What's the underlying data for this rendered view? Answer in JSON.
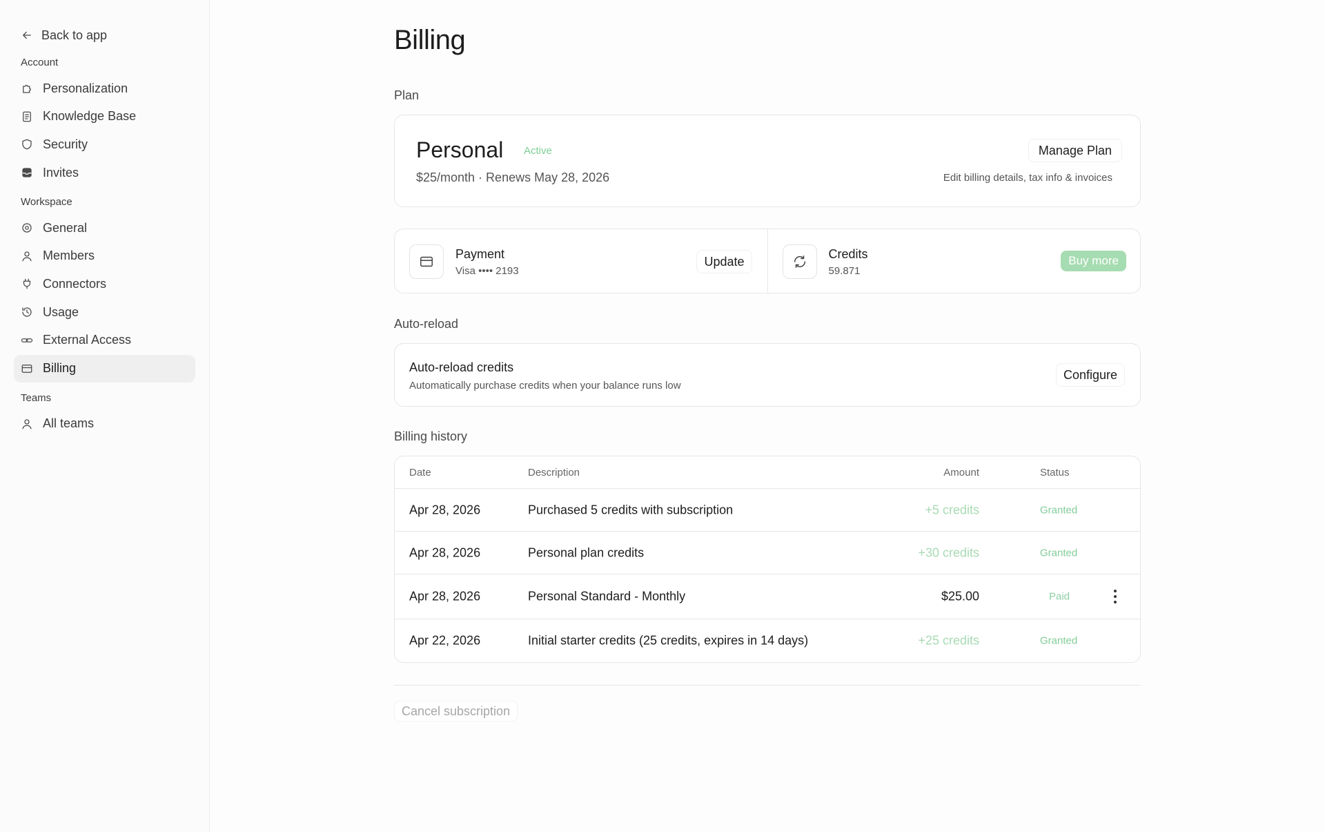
{
  "sidebar": {
    "back_label": "Back to app",
    "sections": [
      {
        "label": "Account",
        "items": [
          {
            "label": "Personalization",
            "icon": "puzzle-icon"
          },
          {
            "label": "Knowledge Base",
            "icon": "book-icon"
          },
          {
            "label": "Security",
            "icon": "shield-icon"
          },
          {
            "label": "Invites",
            "icon": "inbox-icon"
          }
        ]
      },
      {
        "label": "Workspace",
        "items": [
          {
            "label": "General",
            "icon": "gear-icon"
          },
          {
            "label": "Members",
            "icon": "user-icon"
          },
          {
            "label": "Connectors",
            "icon": "plug-icon"
          },
          {
            "label": "Usage",
            "icon": "gauge-icon"
          },
          {
            "label": "External Access",
            "icon": "link-icon"
          },
          {
            "label": "Billing",
            "icon": "credit-card-icon",
            "active": true
          }
        ]
      },
      {
        "label": "Teams",
        "items": [
          {
            "label": "All teams",
            "icon": "user-icon"
          }
        ]
      }
    ]
  },
  "page": {
    "title": "Billing",
    "plan_section": "Plan",
    "plan": {
      "name": "Personal",
      "badge": "Active",
      "meta": "$25/month · Renews May 28, 2026",
      "manage_label": "Manage Plan",
      "manage_sub": "Edit billing details, tax info & invoices"
    },
    "payment": {
      "title": "Payment",
      "sub": "Visa •••• 2193",
      "button": "Update"
    },
    "credits": {
      "title": "Credits",
      "sub": "59.871",
      "button": "Buy more"
    },
    "autoreload_section": "Auto-reload",
    "autoreload": {
      "title": "Auto-reload credits",
      "sub": "Automatically purchase credits when your balance runs low",
      "button": "Configure"
    },
    "history_section": "Billing history",
    "history": {
      "columns": {
        "date": "Date",
        "description": "Description",
        "amount": "Amount",
        "status": "Status"
      },
      "rows": [
        {
          "date": "Apr 28, 2026",
          "description": "Purchased 5 credits with subscription",
          "amount": "+5 credits",
          "status": "Granted"
        },
        {
          "date": "Apr 28, 2026",
          "description": "Personal plan credits",
          "amount": "+30 credits",
          "status": "Granted"
        },
        {
          "date": "Apr 28, 2026",
          "description": "Personal Standard - Monthly",
          "amount": "$25.00",
          "status": "Paid"
        },
        {
          "date": "Apr 22, 2026",
          "description": "Initial starter credits (25 credits, expires in 14 days)",
          "amount": "+25 credits",
          "status": "Granted"
        }
      ]
    },
    "cancel_label": "Cancel subscription"
  },
  "colors": {
    "accent_green": "#82cc98",
    "buy_button_bg": "#a6dcb1",
    "active_nav_bg": "#efefef"
  }
}
